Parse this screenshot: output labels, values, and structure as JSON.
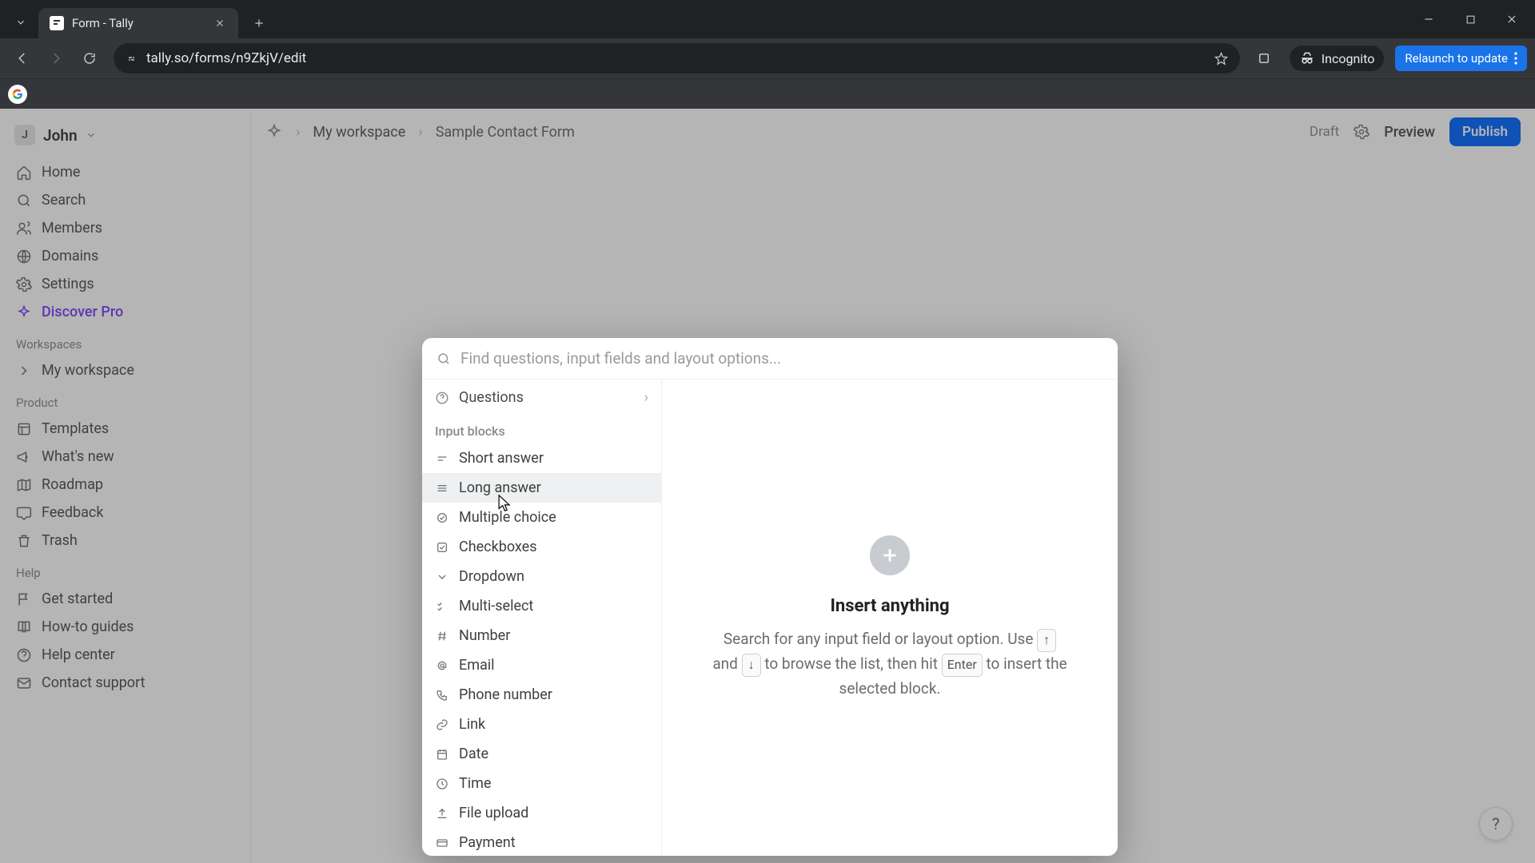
{
  "browser": {
    "tab_title": "Form - Tally",
    "url": "tally.so/forms/n9ZkjV/edit",
    "incognito_label": "Incognito",
    "relaunch_label": "Relaunch to update"
  },
  "sidebar": {
    "user_initial": "J",
    "user_name": "John",
    "nav": {
      "home": "Home",
      "search": "Search",
      "members": "Members",
      "domains": "Domains",
      "settings": "Settings",
      "discover_pro": "Discover Pro"
    },
    "workspaces_header": "Workspaces",
    "workspace_name": "My workspace",
    "product_header": "Product",
    "product": {
      "templates": "Templates",
      "whats_new": "What's new",
      "roadmap": "Roadmap",
      "feedback": "Feedback",
      "trash": "Trash"
    },
    "help_header": "Help",
    "help": {
      "get_started": "Get started",
      "how_to_guides": "How-to guides",
      "help_center": "Help center",
      "contact_support": "Contact support"
    }
  },
  "topbar": {
    "workspace": "My workspace",
    "form_name": "Sample Contact Form",
    "draft": "Draft",
    "preview": "Preview",
    "publish": "Publish"
  },
  "modal": {
    "search_placeholder": "Find questions, input fields and layout options...",
    "questions_label": "Questions",
    "input_blocks_header": "Input blocks",
    "items": {
      "short_answer": "Short answer",
      "long_answer": "Long answer",
      "multiple_choice": "Multiple choice",
      "checkboxes": "Checkboxes",
      "dropdown": "Dropdown",
      "multi_select": "Multi-select",
      "number": "Number",
      "email": "Email",
      "phone_number": "Phone number",
      "link": "Link",
      "date": "Date",
      "time": "Time",
      "file_upload": "File upload",
      "payment": "Payment"
    },
    "right": {
      "title": "Insert anything",
      "desc_1": "Search for any input field or layout option. Use ",
      "desc_2": " and ",
      "desc_3": " to browse the list, then hit ",
      "desc_4": " to insert the selected block.",
      "kbd_up": "↑",
      "kbd_down": "↓",
      "kbd_enter": "Enter"
    }
  },
  "help_fab": "?"
}
